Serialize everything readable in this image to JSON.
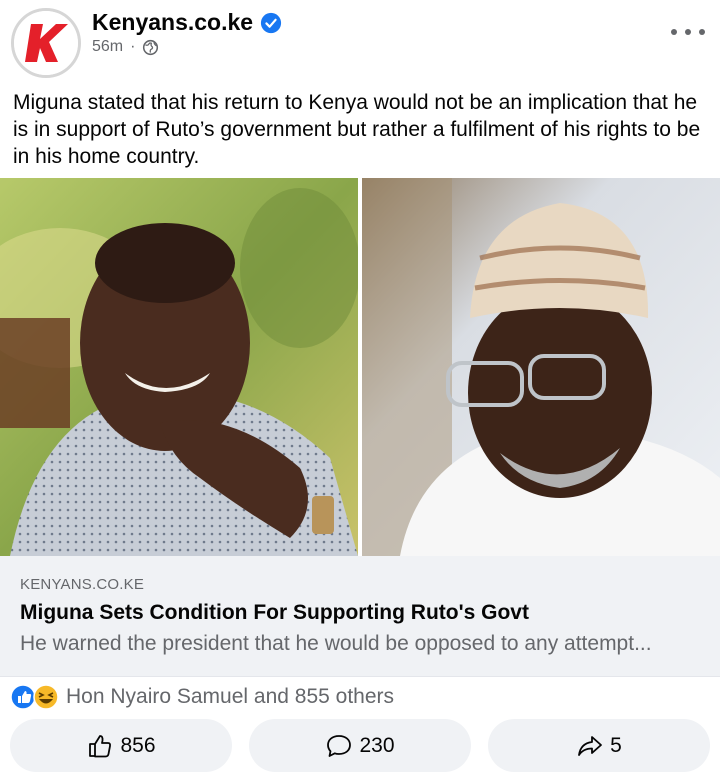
{
  "post": {
    "page_name": "Kenyans.co.ke",
    "time_ago": "56m",
    "separator": "·",
    "audience_icon": "globe-icon",
    "caption": "Miguna stated that his return to Kenya would not be an implication that he is in support of Ruto’s government but rather a fulfilment of his rights to be in his home country."
  },
  "link_preview": {
    "domain": "KENYANS.CO.KE",
    "title": "Miguna Sets Condition For Supporting Ruto's Govt",
    "description": "He warned the president that he would be opposed to any attempt..."
  },
  "reactions": {
    "summary": "Hon Nyairo Samuel and 855 others",
    "types": [
      "like",
      "haha"
    ]
  },
  "actions": {
    "like_count": "856",
    "comment_count": "230",
    "share_count": "5"
  },
  "colors": {
    "brand_red": "#e4202a",
    "verified_blue": "#1877f2",
    "secondary_text": "#65676b",
    "card_bg": "#f0f2f5"
  }
}
